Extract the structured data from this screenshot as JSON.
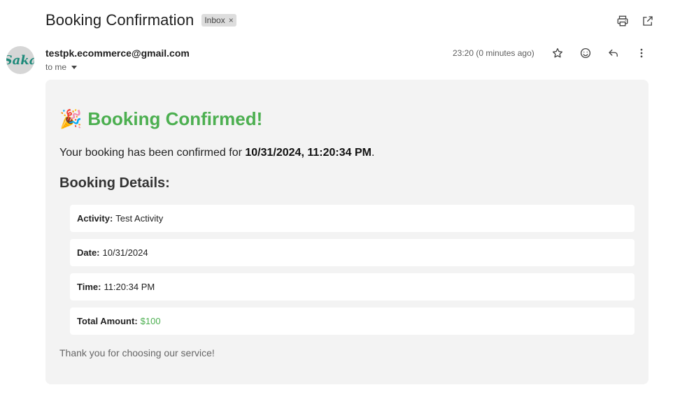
{
  "email": {
    "subject": "Booking Confirmation",
    "label": "Inbox",
    "label_close": "×",
    "sender_avatar_text": "Saka",
    "sender": "testpk.ecommerce@gmail.com",
    "recipient": "to me",
    "time": "23:20 (0 minutes ago)"
  },
  "icons": {
    "print": "print-icon",
    "open_new_window": "open-in-new-window-icon",
    "star": "star-icon",
    "emoji": "emoji-reaction-icon",
    "reply": "reply-icon",
    "more": "more-vert-icon",
    "caret": "chevron-down-icon",
    "party": "party-popper-icon"
  },
  "body": {
    "party_emoji": "🎉",
    "headline": "Booking Confirmed!",
    "intro_prefix": "Your booking has been confirmed for ",
    "intro_datetime": "10/31/2024, 11:20:34 PM",
    "intro_suffix": ".",
    "details_title": "Booking Details:",
    "details": [
      {
        "label": "Activity:",
        "value": "Test Activity"
      },
      {
        "label": "Date:",
        "value": "10/31/2024"
      },
      {
        "label": "Time:",
        "value": "11:20:34 PM"
      },
      {
        "label": "Total Amount:",
        "value": "$100"
      }
    ],
    "thanks": "Thank you for choosing our service!"
  },
  "colors": {
    "accent_green": "#4caf50",
    "card_bg": "#f3f3f3",
    "chip_bg": "#dddddd"
  }
}
